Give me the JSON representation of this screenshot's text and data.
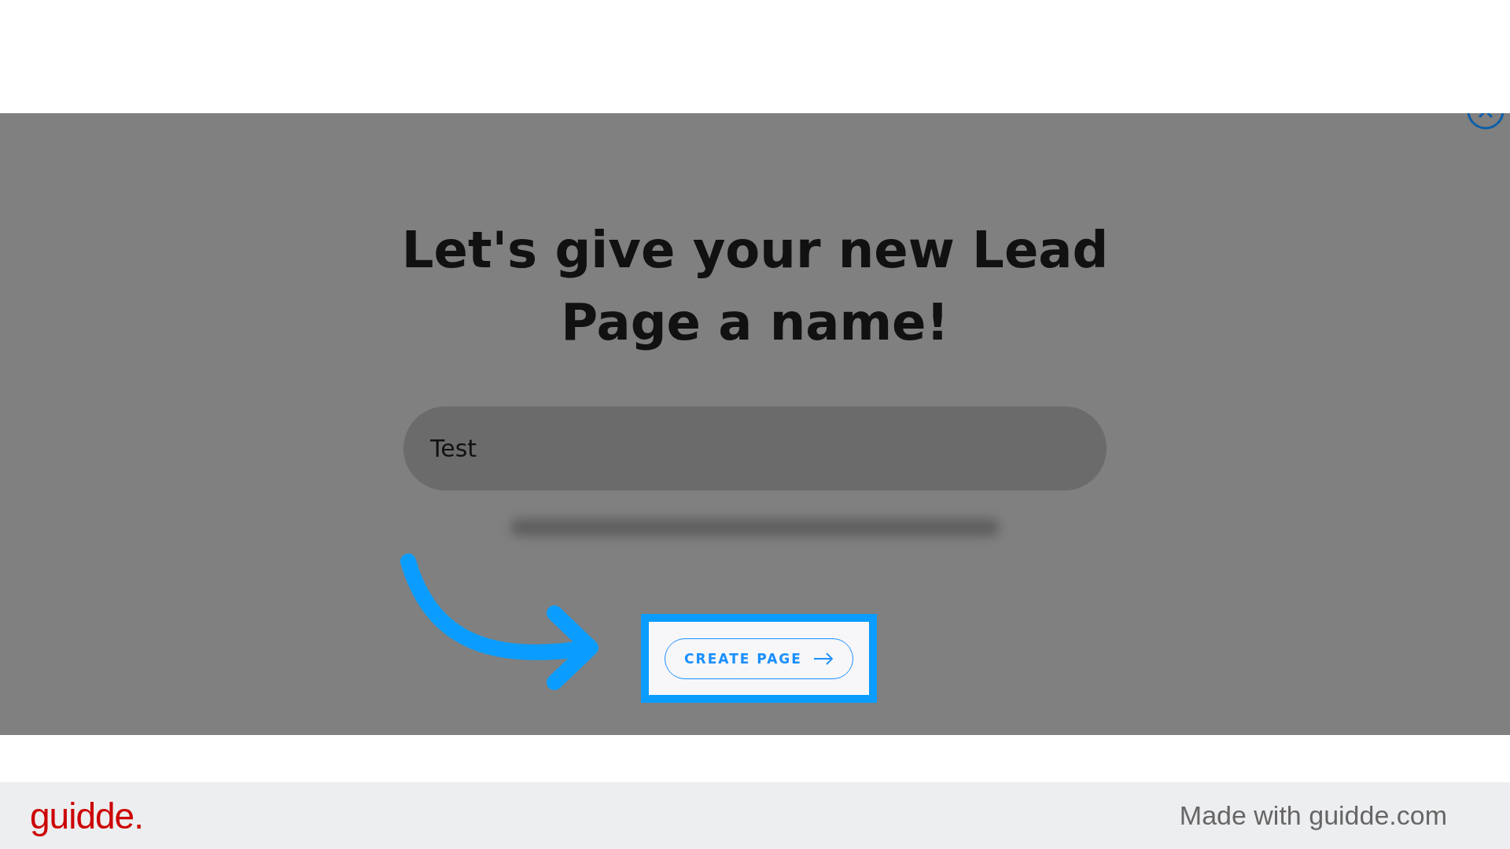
{
  "dialog": {
    "heading": "Let's give your new Lead Page a name!",
    "name_field": {
      "value": "Test"
    },
    "create_button": {
      "label": "CREATE PAGE"
    }
  },
  "footer": {
    "logo": "guidde.",
    "credit": "Made with guidde.com"
  }
}
